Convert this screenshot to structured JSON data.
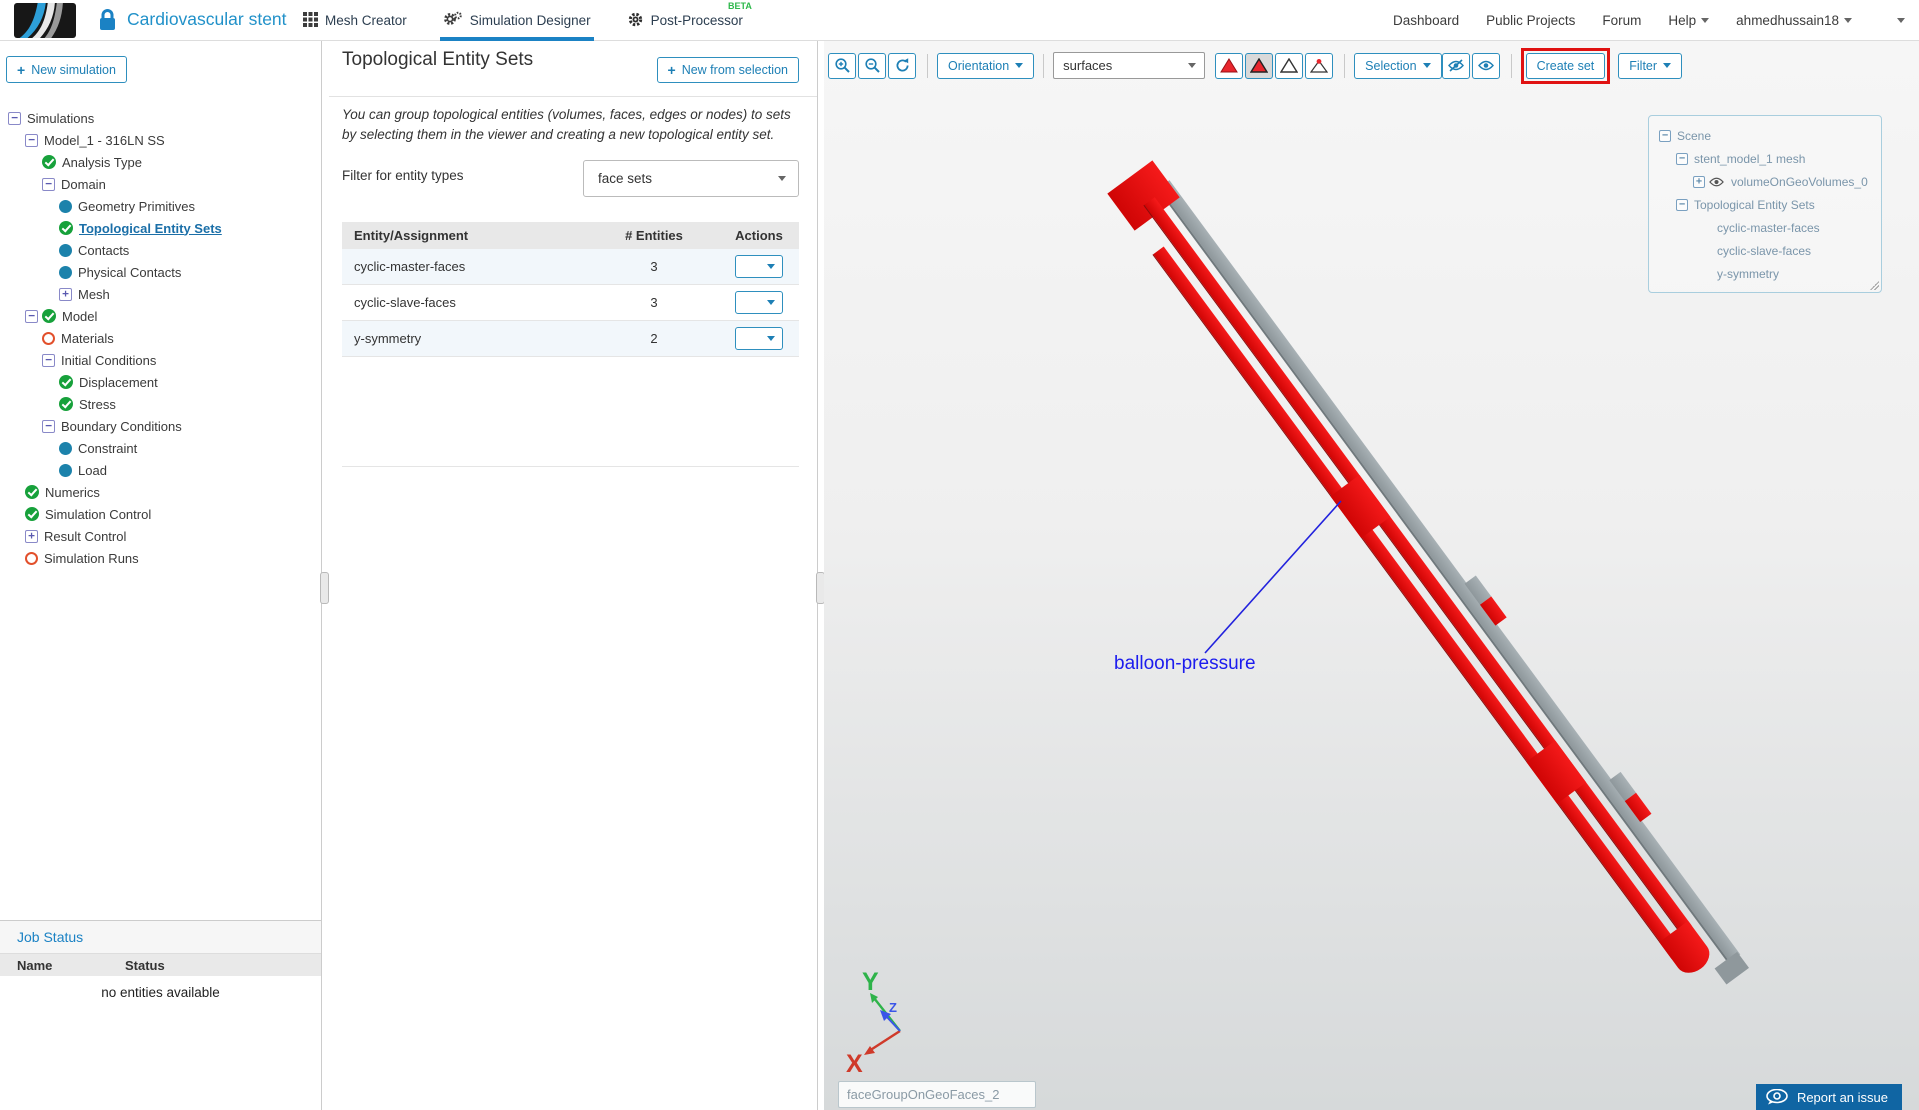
{
  "header": {
    "project_title": "Cardiovascular stent",
    "tabs": [
      {
        "label": "Mesh Creator",
        "icon": "grid",
        "active": false,
        "badge": ""
      },
      {
        "label": "Simulation Designer",
        "icon": "gears",
        "active": true,
        "badge": ""
      },
      {
        "label": "Post-Processor",
        "icon": "gear",
        "active": false,
        "badge": "BETA"
      }
    ],
    "nav_links": [
      {
        "label": "Dashboard",
        "caret": false
      },
      {
        "label": "Public Projects",
        "caret": false
      },
      {
        "label": "Forum",
        "caret": false
      },
      {
        "label": "Help",
        "caret": true
      }
    ],
    "username": "ahmedhussain18"
  },
  "sidebar": {
    "new_simulation_label": "New simulation",
    "tree": [
      {
        "icons": [
          "minus"
        ],
        "label": "Simulations",
        "level": 0,
        "selected": false
      },
      {
        "icons": [
          "minus"
        ],
        "label": "Model_1 - 316LN SS",
        "level": 1,
        "selected": false
      },
      {
        "icons": [
          "check"
        ],
        "label": "Analysis Type",
        "level": 2,
        "selected": false
      },
      {
        "icons": [
          "minus"
        ],
        "label": "Domain",
        "level": 2,
        "selected": false
      },
      {
        "icons": [
          "dot"
        ],
        "label": "Geometry Primitives",
        "level": 3,
        "selected": false
      },
      {
        "icons": [
          "check"
        ],
        "label": "Topological Entity Sets",
        "level": 3,
        "selected": true
      },
      {
        "icons": [
          "dot"
        ],
        "label": "Contacts",
        "level": 3,
        "selected": false
      },
      {
        "icons": [
          "dot"
        ],
        "label": "Physical Contacts",
        "level": 3,
        "selected": false
      },
      {
        "icons": [
          "plus"
        ],
        "label": "Mesh",
        "level": 3,
        "selected": false
      },
      {
        "icons": [
          "minus",
          "check"
        ],
        "label": "Model",
        "level": 1,
        "selected": false
      },
      {
        "icons": [
          "circle"
        ],
        "label": "Materials",
        "level": 2,
        "selected": false
      },
      {
        "icons": [
          "minus"
        ],
        "label": "Initial Conditions",
        "level": 2,
        "selected": false
      },
      {
        "icons": [
          "check"
        ],
        "label": "Displacement",
        "level": 3,
        "selected": false
      },
      {
        "icons": [
          "check"
        ],
        "label": "Stress",
        "level": 3,
        "selected": false
      },
      {
        "icons": [
          "minus"
        ],
        "label": "Boundary Conditions",
        "level": 2,
        "selected": false
      },
      {
        "icons": [
          "dot"
        ],
        "label": "Constraint",
        "level": 3,
        "selected": false
      },
      {
        "icons": [
          "dot"
        ],
        "label": "Load",
        "level": 3,
        "selected": false
      },
      {
        "icons": [
          "check"
        ],
        "label": "Numerics",
        "level": 1,
        "selected": false
      },
      {
        "icons": [
          "check"
        ],
        "label": "Simulation Control",
        "level": 1,
        "selected": false
      },
      {
        "icons": [
          "plus"
        ],
        "label": "Result Control",
        "level": 1,
        "selected": false
      },
      {
        "icons": [
          "circle"
        ],
        "label": "Simulation Runs",
        "level": 1,
        "selected": false
      }
    ]
  },
  "job_status": {
    "title": "Job Status",
    "columns": [
      "Name",
      "Status"
    ],
    "empty_message": "no entities available"
  },
  "panel": {
    "title": "Topological Entity Sets",
    "new_from_selection_label": "New from selection",
    "description": "You can group topological entities (volumes, faces, edges or nodes) to sets by selecting them in the viewer and creating a new topological entity set.",
    "filter_label": "Filter for entity types",
    "filter_value": "face sets",
    "table": {
      "columns": [
        "Entity/Assignment",
        "# Entities",
        "Actions"
      ],
      "rows": [
        {
          "name": "cyclic-master-faces",
          "entities": "3"
        },
        {
          "name": "cyclic-slave-faces",
          "entities": "3"
        },
        {
          "name": "y-symmetry",
          "entities": "2"
        }
      ]
    }
  },
  "viewer": {
    "toolbar": {
      "orientation_label": "Orientation",
      "display_mode_value": "surfaces",
      "selection_label": "Selection",
      "create_set_label": "Create set",
      "filter_label": "Filter"
    },
    "scene_tree": [
      {
        "icons": [
          "minus"
        ],
        "label": "Scene",
        "level": 0
      },
      {
        "icons": [
          "minus"
        ],
        "label": "stent_model_1 mesh",
        "level": 1
      },
      {
        "icons": [
          "plus",
          "eye"
        ],
        "label": "volumeOnGeoVolumes_0",
        "level": 2
      },
      {
        "icons": [
          "minus"
        ],
        "label": "Topological Entity Sets",
        "level": 1
      },
      {
        "icons": [],
        "label": "cyclic-master-faces",
        "level": 2
      },
      {
        "icons": [],
        "label": "cyclic-slave-faces",
        "level": 2
      },
      {
        "icons": [],
        "label": "y-symmetry",
        "level": 2
      }
    ],
    "annotation_label": "balloon-pressure",
    "axes": {
      "x": "X",
      "y": "Y",
      "z": "Z"
    },
    "name_input_value": "faceGroupOnGeoFaces_2",
    "report_issue_label": "Report an issue",
    "colors": {
      "accent_blue": "#1b82c4",
      "highlight_red_box": "#e01212",
      "stent_red": "#e60d0d",
      "stent_gray": "#9aa3a7",
      "annotation_blue": "#1c1cee",
      "axis_x_red": "#d93025",
      "axis_y_green": "#2eb34a",
      "axis_z_blue": "#3a55e8",
      "check_green": "#17a13b",
      "beta_green": "#2eb84b"
    }
  }
}
